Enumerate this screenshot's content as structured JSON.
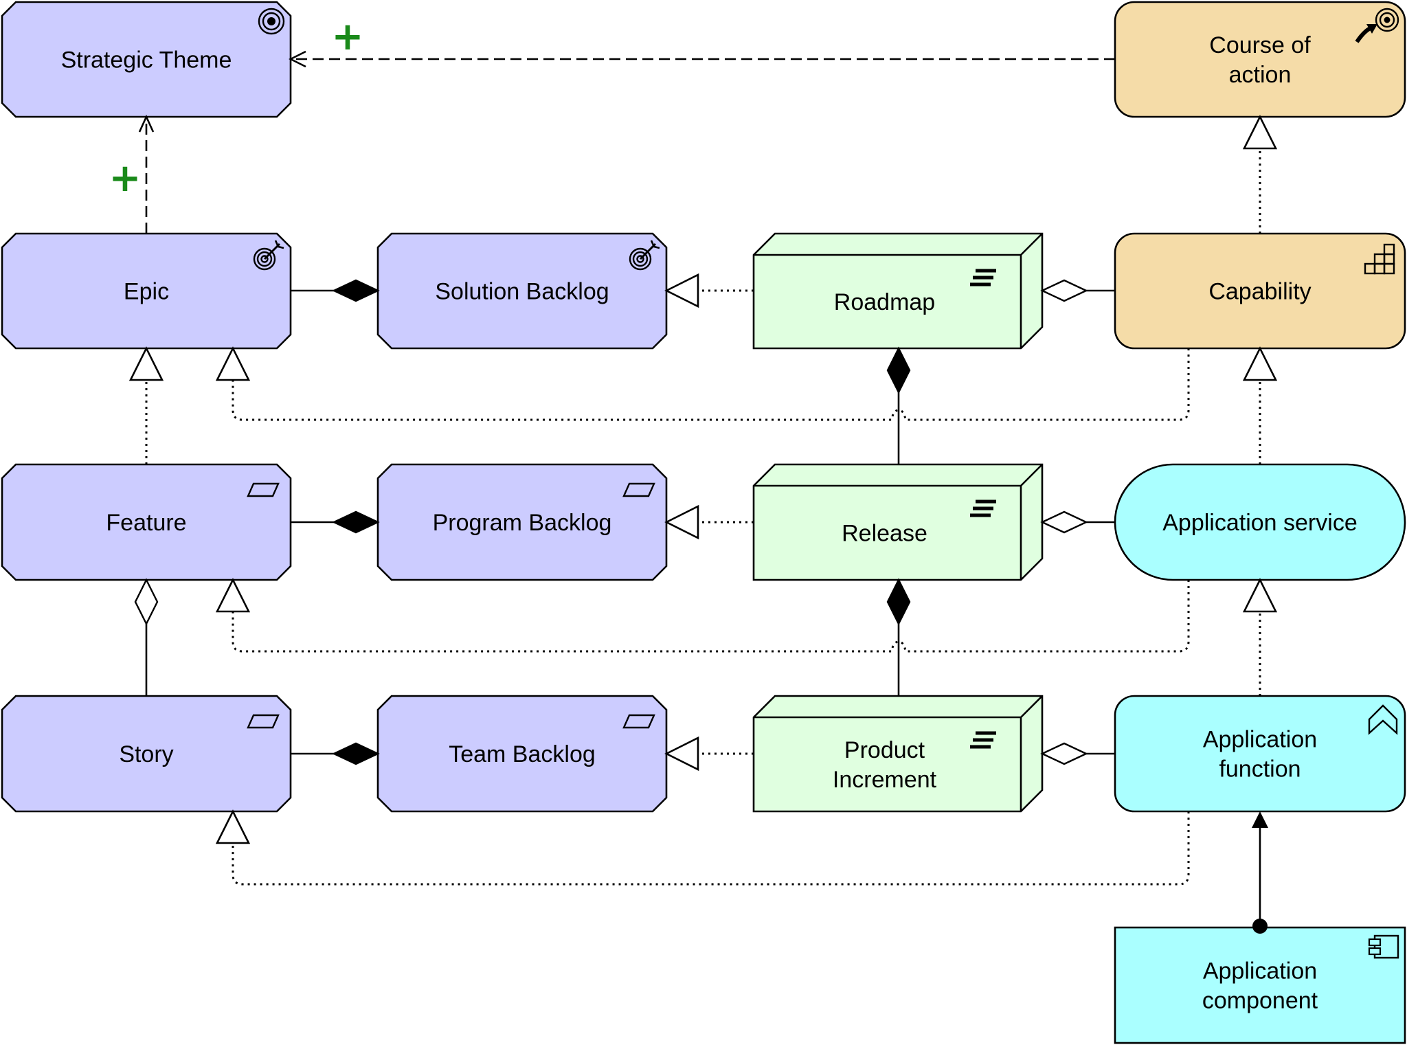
{
  "diagram": {
    "type": "ArchiMate-style relationship diagram",
    "colors": {
      "strategy_motivation": "#ccccff",
      "strategy_element": "#f5dca8",
      "implementation_deliverable": "#e0ffe0",
      "application": "#aaffff",
      "line": "#000000",
      "plus_marker": "#1a8a1a"
    },
    "nodes": [
      {
        "id": "strategic_theme",
        "label_lines": [
          "Strategic Theme"
        ],
        "icon": "goal-icon",
        "shape": "octagon",
        "color_key": "strategy_motivation"
      },
      {
        "id": "course_of_action",
        "label_lines": [
          "Course of",
          "action"
        ],
        "icon": "course-of-action-icon",
        "shape": "rounded-rect",
        "color_key": "strategy_element"
      },
      {
        "id": "epic",
        "label_lines": [
          "Epic"
        ],
        "icon": "outcome-icon",
        "shape": "octagon",
        "color_key": "strategy_motivation"
      },
      {
        "id": "solution_backlog",
        "label_lines": [
          "Solution Backlog"
        ],
        "icon": "outcome-icon",
        "shape": "octagon",
        "color_key": "strategy_motivation"
      },
      {
        "id": "roadmap",
        "label_lines": [
          "Roadmap"
        ],
        "icon": "deliverable-icon",
        "shape": "3d-box",
        "color_key": "implementation_deliverable"
      },
      {
        "id": "capability",
        "label_lines": [
          "Capability"
        ],
        "icon": "capability-icon",
        "shape": "rounded-rect",
        "color_key": "strategy_element"
      },
      {
        "id": "feature",
        "label_lines": [
          "Feature"
        ],
        "icon": "requirement-icon",
        "shape": "octagon",
        "color_key": "strategy_motivation"
      },
      {
        "id": "program_backlog",
        "label_lines": [
          "Program Backlog"
        ],
        "icon": "requirement-icon",
        "shape": "octagon",
        "color_key": "strategy_motivation"
      },
      {
        "id": "release",
        "label_lines": [
          "Release"
        ],
        "icon": "deliverable-icon",
        "shape": "3d-box",
        "color_key": "implementation_deliverable"
      },
      {
        "id": "application_service",
        "label_lines": [
          "Application service"
        ],
        "icon": "",
        "shape": "pill",
        "color_key": "application"
      },
      {
        "id": "story",
        "label_lines": [
          "Story"
        ],
        "icon": "requirement-icon",
        "shape": "octagon",
        "color_key": "strategy_motivation"
      },
      {
        "id": "team_backlog",
        "label_lines": [
          "Team Backlog"
        ],
        "icon": "requirement-icon",
        "shape": "octagon",
        "color_key": "strategy_motivation"
      },
      {
        "id": "product_increment",
        "label_lines": [
          "Product",
          "Increment"
        ],
        "icon": "deliverable-icon",
        "shape": "3d-box",
        "color_key": "implementation_deliverable"
      },
      {
        "id": "application_function",
        "label_lines": [
          "Application",
          "function"
        ],
        "icon": "function-icon",
        "shape": "rounded-rect",
        "color_key": "application"
      },
      {
        "id": "application_component",
        "label_lines": [
          "Application",
          "component"
        ],
        "icon": "component-icon",
        "shape": "rect",
        "color_key": "application"
      }
    ],
    "edges": [
      {
        "from": "epic",
        "to": "strategic_theme",
        "type": "influence",
        "marker": "+"
      },
      {
        "from": "course_of_action",
        "to": "strategic_theme",
        "type": "influence",
        "marker": "+"
      },
      {
        "from": "capability",
        "to": "course_of_action",
        "type": "realization"
      },
      {
        "from": "epic",
        "to": "solution_backlog",
        "type": "composition"
      },
      {
        "from": "roadmap",
        "to": "solution_backlog",
        "type": "realization"
      },
      {
        "from": "capability",
        "to": "roadmap",
        "type": "aggregation"
      },
      {
        "from": "release",
        "to": "roadmap",
        "type": "composition"
      },
      {
        "from": "capability",
        "to": "epic",
        "type": "realization"
      },
      {
        "from": "feature",
        "to": "epic",
        "type": "realization"
      },
      {
        "from": "application_service",
        "to": "capability",
        "type": "realization"
      },
      {
        "from": "feature",
        "to": "program_backlog",
        "type": "composition"
      },
      {
        "from": "release",
        "to": "program_backlog",
        "type": "realization"
      },
      {
        "from": "application_service",
        "to": "release",
        "type": "aggregation"
      },
      {
        "from": "product_increment",
        "to": "release",
        "type": "composition"
      },
      {
        "from": "application_service",
        "to": "feature",
        "type": "realization"
      },
      {
        "from": "story",
        "to": "feature",
        "type": "aggregation"
      },
      {
        "from": "application_function",
        "to": "application_service",
        "type": "realization"
      },
      {
        "from": "story",
        "to": "team_backlog",
        "type": "composition"
      },
      {
        "from": "product_increment",
        "to": "team_backlog",
        "type": "realization"
      },
      {
        "from": "application_function",
        "to": "product_increment",
        "type": "aggregation"
      },
      {
        "from": "application_function",
        "to": "story",
        "type": "realization"
      },
      {
        "from": "application_component",
        "to": "application_function",
        "type": "assignment"
      }
    ]
  }
}
